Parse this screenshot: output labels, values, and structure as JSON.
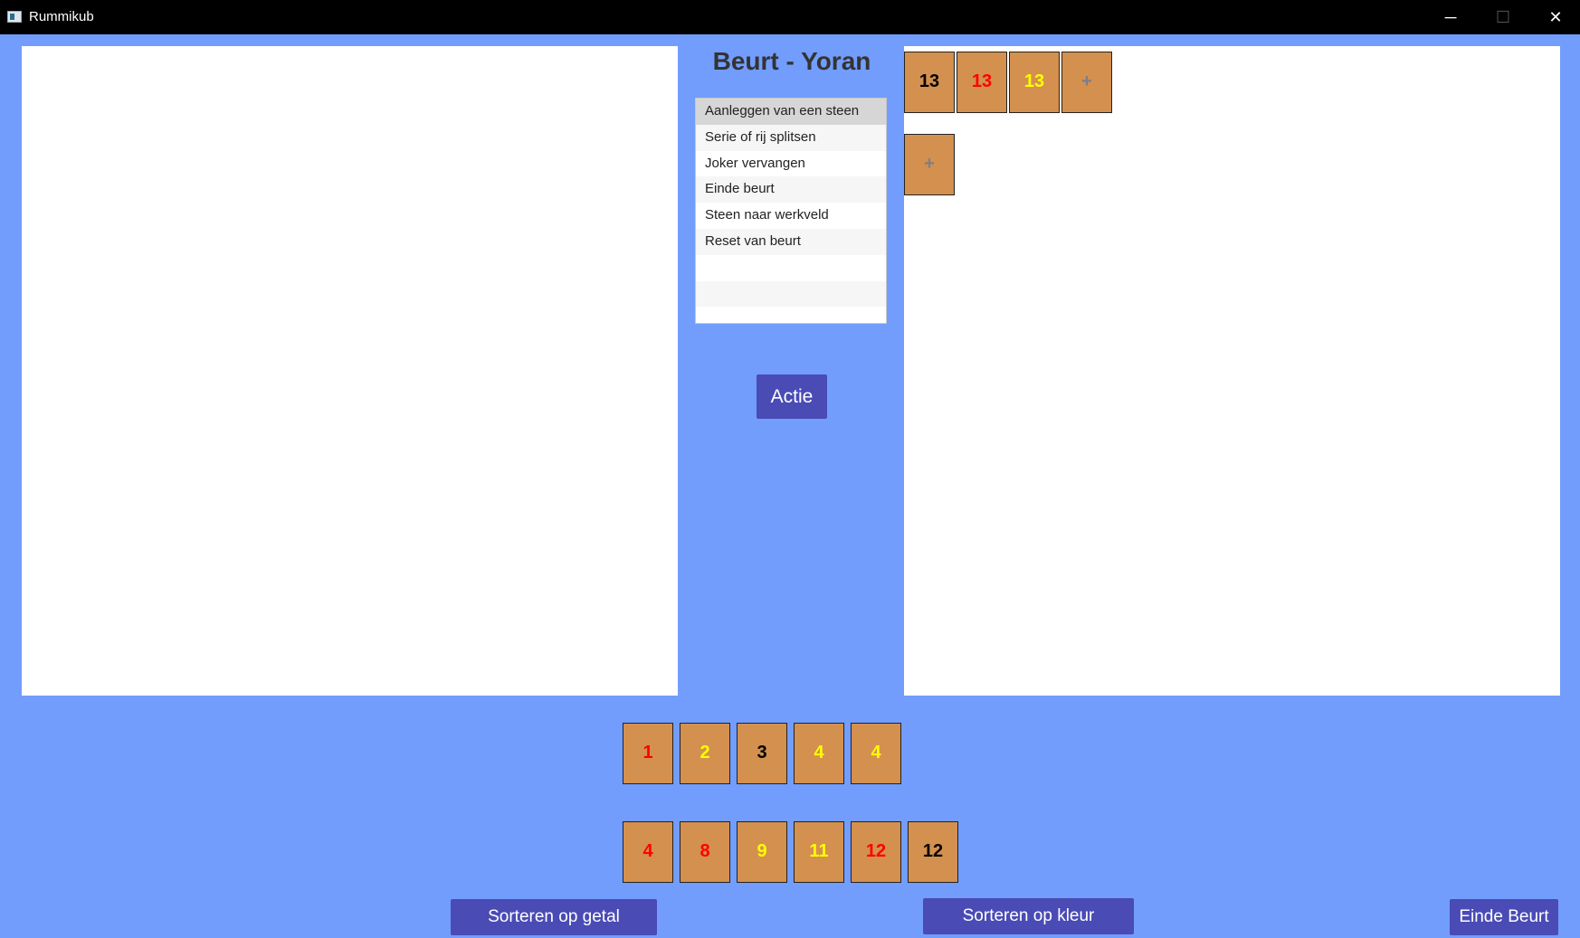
{
  "window": {
    "title": "Rummikub",
    "minimize": "─",
    "maximize": "☐",
    "close": "✕"
  },
  "turn": {
    "title": "Beurt - Yoran"
  },
  "actions": {
    "items": [
      "Aanleggen van een steen",
      "Serie of rij splitsen",
      "Joker vervangen",
      "Einde beurt",
      "Steen naar werkveld",
      "Reset van beurt"
    ],
    "selected_index": 0,
    "button": "Actie"
  },
  "workfield": {
    "rows": [
      {
        "tiles": [
          {
            "value": "13",
            "color": "#000000"
          },
          {
            "value": "13",
            "color": "#ff0000"
          },
          {
            "value": "13",
            "color": "#ffff00"
          }
        ],
        "add_label": "+"
      },
      {
        "tiles": [],
        "add_label": "+"
      }
    ]
  },
  "rack": {
    "rows": [
      [
        {
          "value": "1",
          "color": "#ff0000"
        },
        {
          "value": "2",
          "color": "#ffff00"
        },
        {
          "value": "3",
          "color": "#000000"
        },
        {
          "value": "4",
          "color": "#ffff00"
        },
        {
          "value": "4",
          "color": "#ffff00"
        }
      ],
      [
        {
          "value": "4",
          "color": "#ff0000"
        },
        {
          "value": "8",
          "color": "#ff0000"
        },
        {
          "value": "9",
          "color": "#ffff00"
        },
        {
          "value": "11",
          "color": "#ffff00"
        },
        {
          "value": "12",
          "color": "#ff0000"
        },
        {
          "value": "12",
          "color": "#000000"
        }
      ]
    ]
  },
  "buttons": {
    "sort_number": "Sorteren op getal",
    "sort_color": "Sorteren op kleur",
    "end_turn": "Einde Beurt"
  },
  "colors": {
    "background": "#729dfd",
    "tile": "#d4904e",
    "button": "#4a4bb5"
  }
}
